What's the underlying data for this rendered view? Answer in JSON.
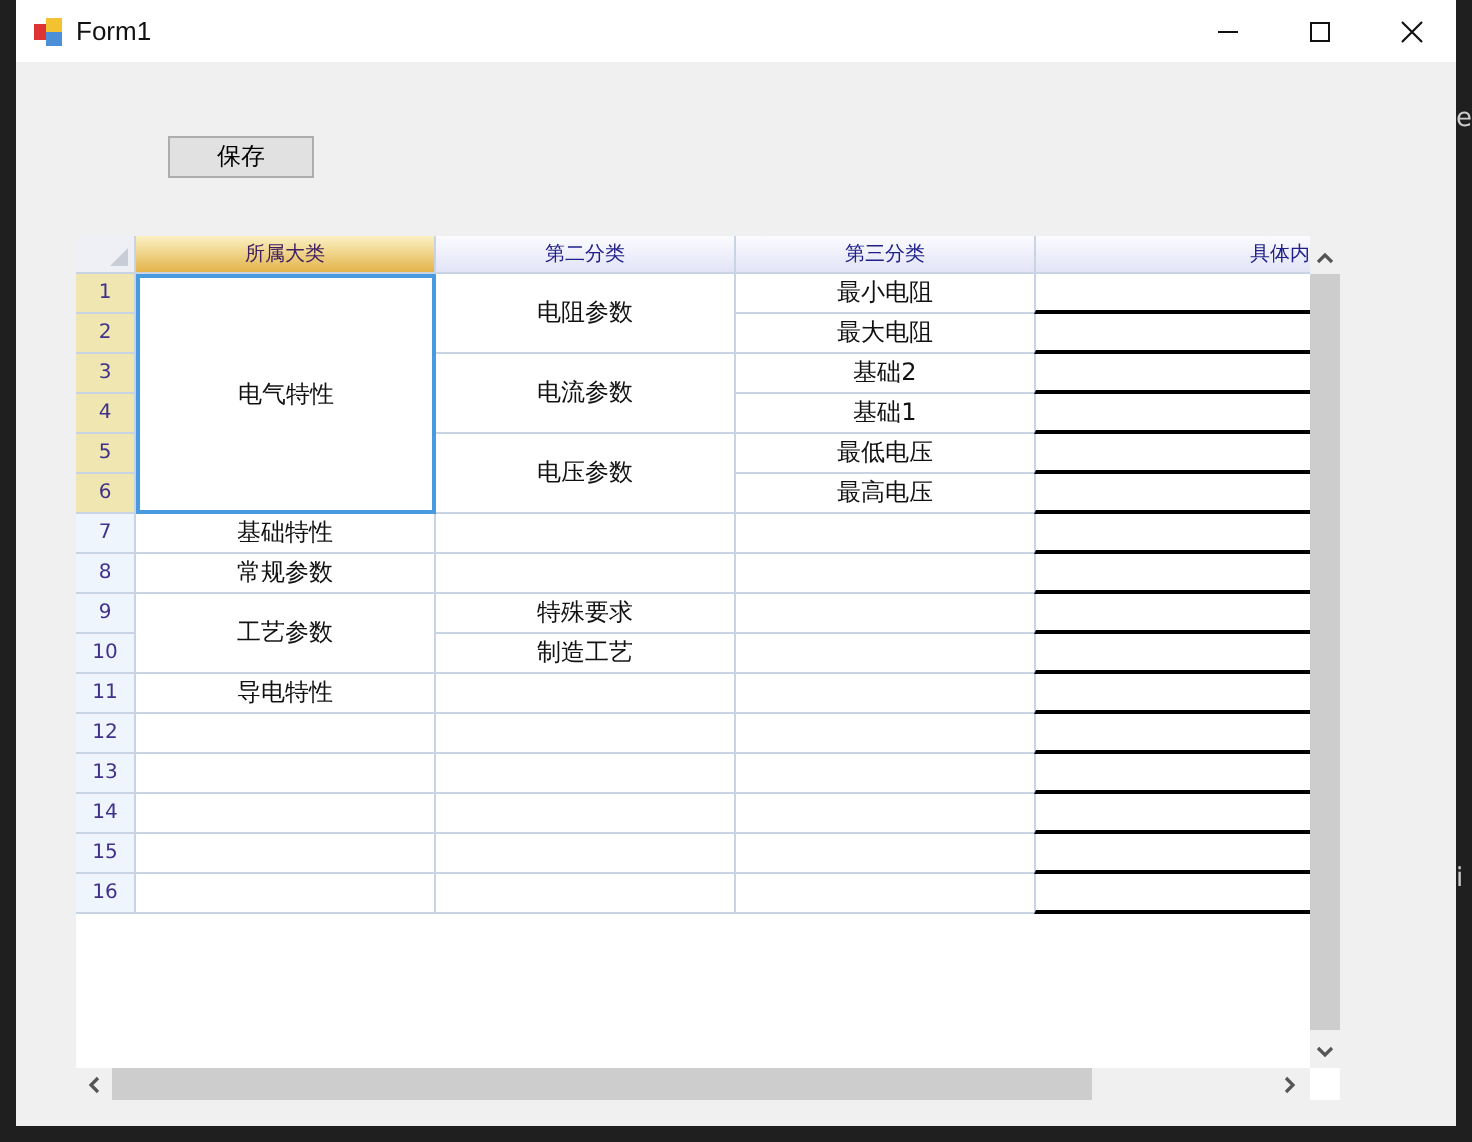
{
  "window": {
    "title": "Form1"
  },
  "save_button": "保存",
  "table": {
    "columns": [
      {
        "label": "所属大类",
        "selected": true
      },
      {
        "label": "第二分类",
        "selected": false
      },
      {
        "label": "第三分类",
        "selected": false
      },
      {
        "label": "具体内",
        "selected": false
      }
    ],
    "row_headers": [
      {
        "label": "1",
        "selected": true
      },
      {
        "label": "2",
        "selected": true
      },
      {
        "label": "3",
        "selected": true
      },
      {
        "label": "4",
        "selected": true
      },
      {
        "label": "5",
        "selected": true
      },
      {
        "label": "6",
        "selected": true
      },
      {
        "label": "7",
        "selected": false
      },
      {
        "label": "8",
        "selected": false
      },
      {
        "label": "9",
        "selected": false
      },
      {
        "label": "10",
        "selected": false
      },
      {
        "label": "11",
        "selected": false
      },
      {
        "label": "12",
        "selected": false
      },
      {
        "label": "13",
        "selected": false
      },
      {
        "label": "14",
        "selected": false
      },
      {
        "label": "15",
        "selected": false
      },
      {
        "label": "16",
        "selected": false
      }
    ],
    "groups": [
      {
        "text": "电气特性",
        "selected": true,
        "children": [
          {
            "text": "电阻参数",
            "selected": false,
            "children": [
              {
                "text": "最小电阻",
                "selected": false
              },
              {
                "text": "最大电阻",
                "selected": false
              }
            ]
          },
          {
            "text": "电流参数",
            "selected": false,
            "children": [
              {
                "text": "基础2",
                "selected": false
              },
              {
                "text": "基础1",
                "selected": false
              }
            ]
          },
          {
            "text": "电压参数",
            "selected": false,
            "children": [
              {
                "text": "最低电压",
                "selected": false
              },
              {
                "text": "最高电压",
                "selected": false
              }
            ]
          }
        ]
      },
      {
        "text": "基础特性",
        "selected": false
      },
      {
        "text": "常规参数",
        "selected": false
      },
      {
        "text": "工艺参数",
        "selected": false,
        "children": [
          {
            "text": "特殊要求",
            "selected": false
          },
          {
            "text": "制造工艺",
            "selected": false
          }
        ]
      },
      {
        "text": "导电特性",
        "selected": false
      },
      {
        "selected": false
      },
      {
        "selected": false
      },
      {
        "selected": false
      },
      {
        "selected": false
      },
      {
        "selected": false
      }
    ]
  },
  "background_texts": [
    "e",
    "i"
  ]
}
